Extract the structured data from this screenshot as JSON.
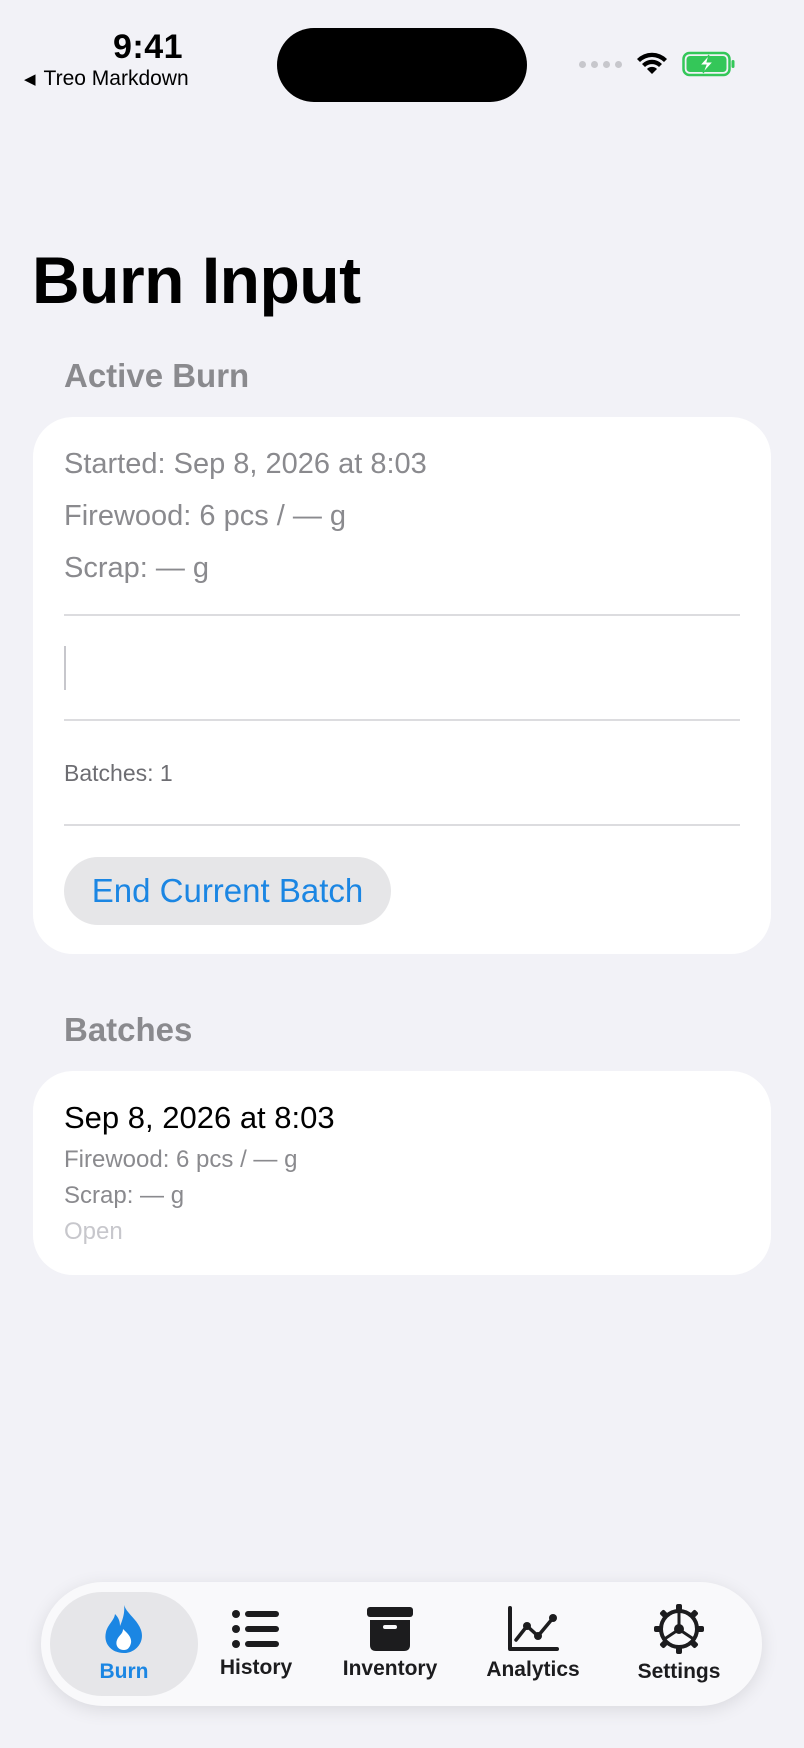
{
  "status_bar": {
    "time": "9:41",
    "back_app": "Treo Markdown",
    "back_icon": "back-triangle-icon",
    "wifi_icon": "wifi-icon",
    "battery_icon": "battery-charging-icon"
  },
  "page": {
    "title": "Burn Input"
  },
  "active_burn": {
    "header": "Active Burn",
    "started": "Started: Sep 8, 2026 at 8:03",
    "firewood": "Firewood: 6 pcs / — g",
    "scrap": "Scrap: — g",
    "note_value": "",
    "batches_count": "Batches: 1",
    "end_button": "End Current Batch"
  },
  "batches": {
    "header": "Batches",
    "items": [
      {
        "date": "Sep 8, 2026 at 8:03",
        "firewood": "Firewood: 6 pcs / — g",
        "scrap": "Scrap: — g",
        "status": "Open"
      }
    ]
  },
  "tabbar": {
    "accent": "#1b86e3",
    "tabs": [
      {
        "label": "Burn",
        "icon": "flame-icon",
        "active": true
      },
      {
        "label": "History",
        "icon": "list-icon",
        "active": false
      },
      {
        "label": "Inventory",
        "icon": "archive-box-icon",
        "active": false
      },
      {
        "label": "Analytics",
        "icon": "line-chart-icon",
        "active": false
      },
      {
        "label": "Settings",
        "icon": "gear-icon",
        "active": false
      }
    ]
  }
}
